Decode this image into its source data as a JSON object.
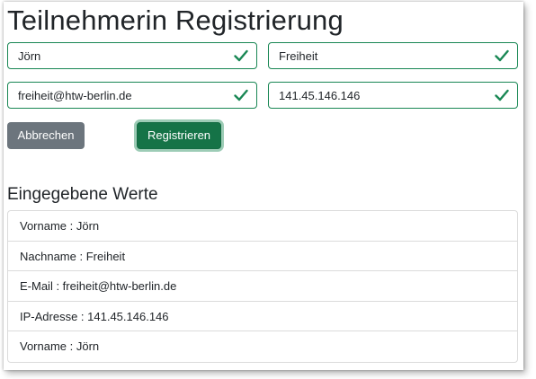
{
  "page": {
    "title": "Teilnehmerin Registrierung"
  },
  "form": {
    "first_name": "Jörn",
    "last_name": "Freiheit",
    "email": "freiheit@htw-berlin.de",
    "ip": "141.45.146.146",
    "cancel_label": "Abbrechen",
    "submit_label": "Registrieren"
  },
  "summary": {
    "title": "Eingegebene Werte",
    "items": [
      "Vorname : Jörn",
      "Nachname : Freiheit",
      "E-Mail : freiheit@htw-berlin.de",
      "IP-Adresse : 141.45.146.146",
      "Vorname : Jörn"
    ]
  },
  "colors": {
    "valid": "#198754",
    "button_secondary": "#6c757d",
    "button_success": "#157347"
  },
  "icons": {
    "valid_field": "check-icon"
  }
}
